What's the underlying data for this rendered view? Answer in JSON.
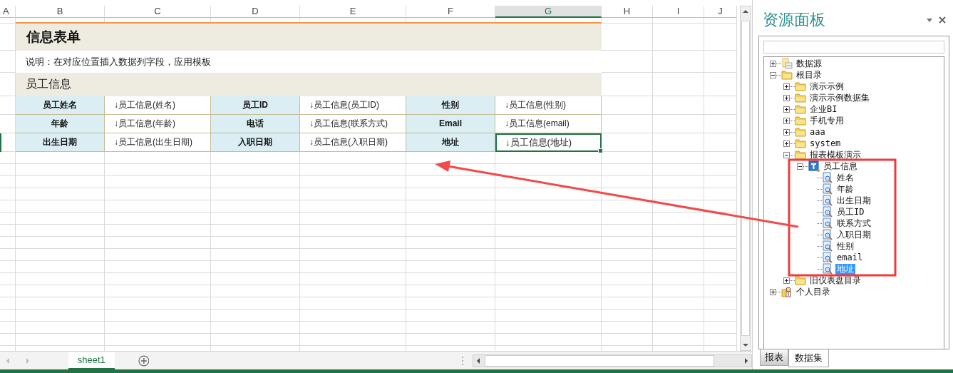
{
  "columns": [
    {
      "label": "A",
      "selected": false
    },
    {
      "label": "B",
      "selected": false
    },
    {
      "label": "C",
      "selected": false
    },
    {
      "label": "D",
      "selected": false
    },
    {
      "label": "E",
      "selected": false
    },
    {
      "label": "F",
      "selected": false
    },
    {
      "label": "G",
      "selected": true
    },
    {
      "label": "H",
      "selected": false
    },
    {
      "label": "I",
      "selected": false
    },
    {
      "label": "J",
      "selected": false
    }
  ],
  "form": {
    "title": "信息表单",
    "description": "说明：在对应位置插入数据列字段，应用模板",
    "section": "员工信息",
    "rows": [
      [
        {
          "label": "员工姓名",
          "value": "↓员工信息(姓名)",
          "selected": false
        },
        {
          "label": "员工ID",
          "value": "↓员工信息(员工ID)",
          "selected": false
        },
        {
          "label": "性别",
          "value": "↓员工信息(性别)",
          "selected": false
        }
      ],
      [
        {
          "label": "年龄",
          "value": "↓员工信息(年龄)",
          "selected": false
        },
        {
          "label": "电话",
          "value": "↓员工信息(联系方式)",
          "selected": false
        },
        {
          "label": "Email",
          "value": "↓员工信息(email)",
          "selected": false
        }
      ],
      [
        {
          "label": "出生日期",
          "value": "↓员工信息(出生日期)",
          "selected": false
        },
        {
          "label": "入职日期",
          "value": "↓员工信息(入职日期)",
          "selected": false
        },
        {
          "label": "地址",
          "value": "↓员工信息(地址)",
          "selected": true
        }
      ]
    ]
  },
  "sheet_tabs": [
    {
      "label": "sheet1",
      "selected": true
    }
  ],
  "panel": {
    "title": "资源面板",
    "tree": [
      {
        "label": "数据源",
        "kind": "datasource",
        "expanded": false
      },
      {
        "label": "根目录",
        "kind": "folder",
        "expanded": true,
        "children": [
          {
            "label": "演示示例",
            "kind": "folder",
            "expanded": false
          },
          {
            "label": "演示示例数据集",
            "kind": "folder",
            "expanded": false
          },
          {
            "label": "企业BI",
            "kind": "folder",
            "expanded": false
          },
          {
            "label": "手机专用",
            "kind": "folder",
            "expanded": false
          },
          {
            "label": "aaa",
            "kind": "folder",
            "expanded": false
          },
          {
            "label": "system",
            "kind": "folder",
            "expanded": false
          },
          {
            "label": "报表模板演示",
            "kind": "folder",
            "expanded": true,
            "children": [
              {
                "label": "员工信息",
                "kind": "table",
                "expanded": true,
                "children": [
                  {
                    "label": "姓名",
                    "kind": "field",
                    "selected": false
                  },
                  {
                    "label": "年龄",
                    "kind": "field",
                    "selected": false
                  },
                  {
                    "label": "出生日期",
                    "kind": "field",
                    "selected": false
                  },
                  {
                    "label": "员工ID",
                    "kind": "field",
                    "selected": false
                  },
                  {
                    "label": "联系方式",
                    "kind": "field",
                    "selected": false
                  },
                  {
                    "label": "入职日期",
                    "kind": "field",
                    "selected": false
                  },
                  {
                    "label": "性别",
                    "kind": "field",
                    "selected": false
                  },
                  {
                    "label": "email",
                    "kind": "field",
                    "selected": false
                  },
                  {
                    "label": "地址",
                    "kind": "field",
                    "selected": true
                  }
                ]
              }
            ]
          },
          {
            "label": "旧仪表盘目录",
            "kind": "folder",
            "expanded": false
          }
        ]
      },
      {
        "label": "个人目录",
        "kind": "user",
        "expanded": false
      }
    ],
    "tabs": [
      {
        "label": "报表",
        "selected": false
      },
      {
        "label": "数据集",
        "selected": true
      }
    ]
  }
}
